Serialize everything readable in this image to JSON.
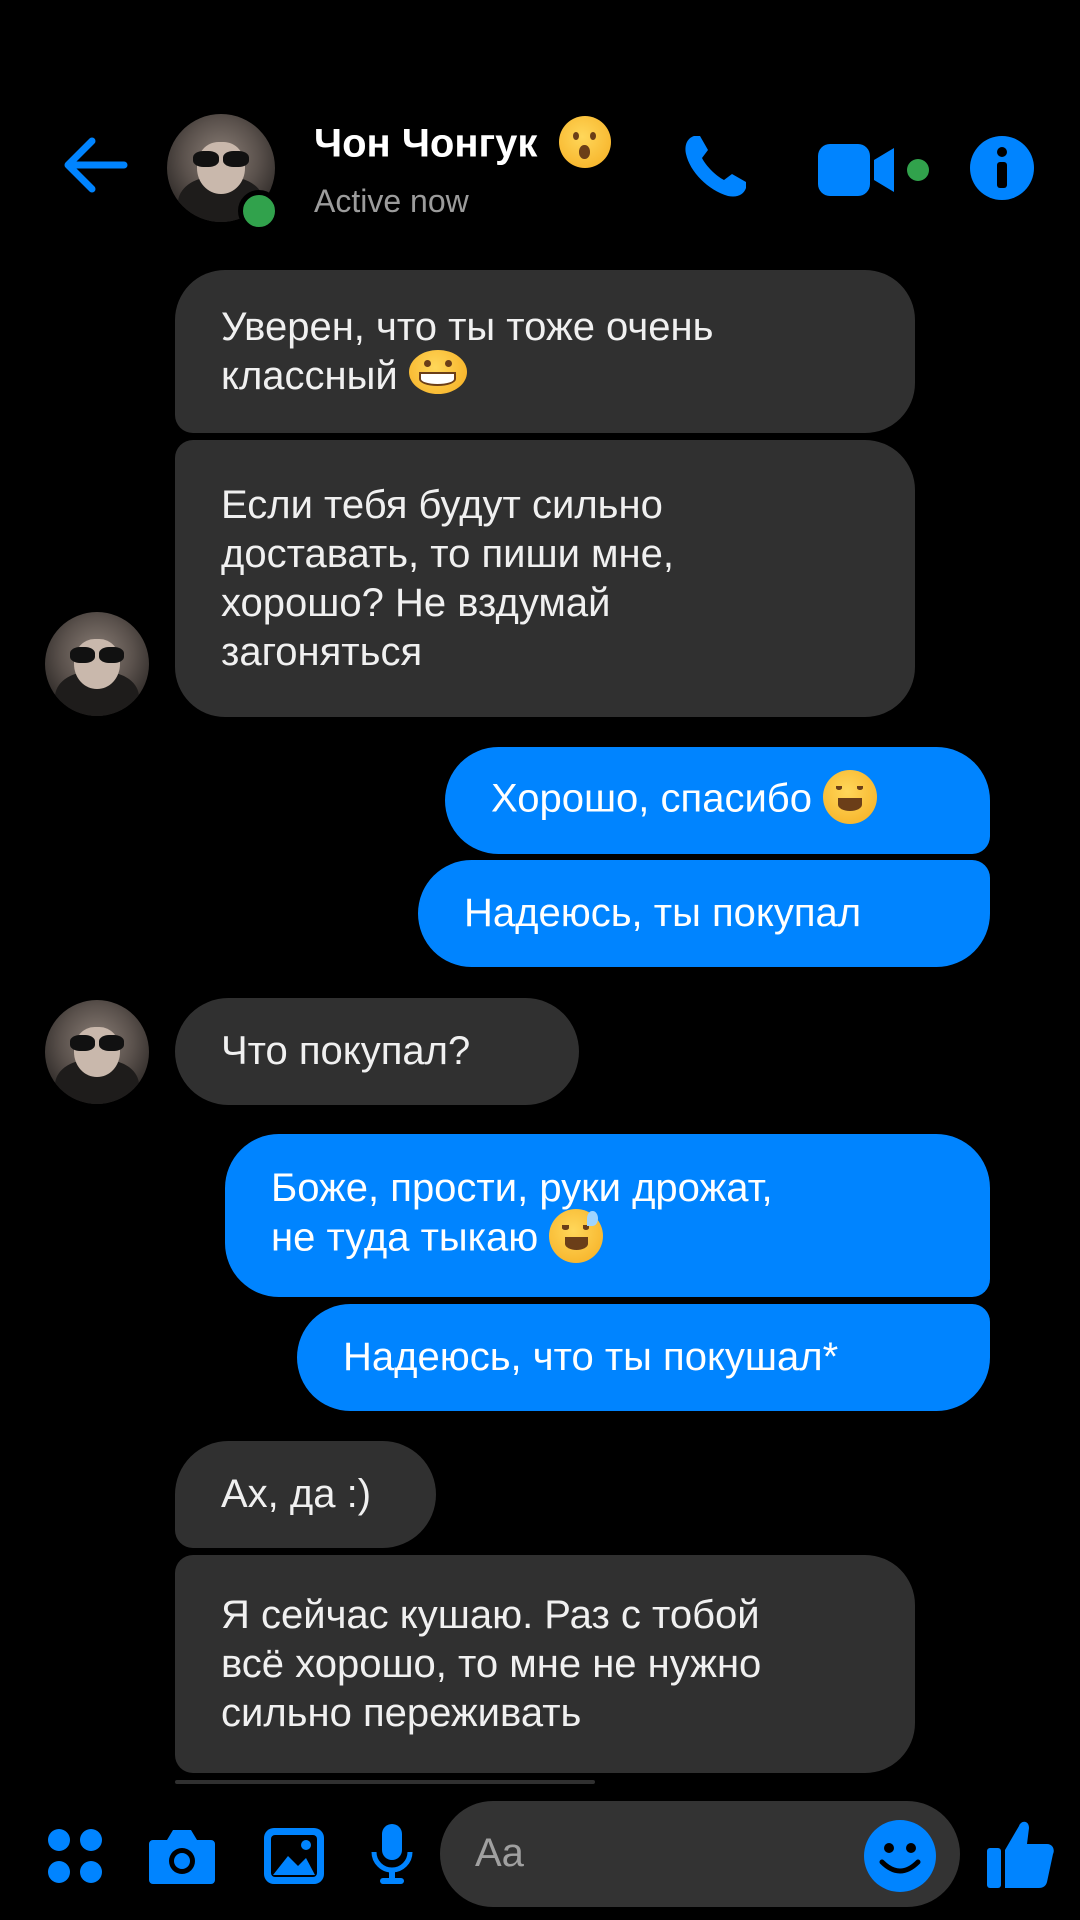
{
  "header": {
    "contact_name": "Чон Чонгук",
    "status": "Active now",
    "name_emoji": "surprised-face-emoji"
  },
  "colors": {
    "accent": "#0084ff",
    "incoming_bubble": "#303030",
    "online": "#31a24c",
    "background": "#000000"
  },
  "messages": [
    {
      "direction": "in",
      "text": "Уверен, что ты тоже очень\nклассный",
      "emoji": "grinning-face-emoji"
    },
    {
      "direction": "in",
      "text": "Если тебя будут сильно\nдоставать, то пиши мне,\nхорошо? Не вздумай\nзагоняться"
    },
    {
      "direction": "out",
      "text": "Хорошо, спасибо",
      "emoji": "smiling-face-emoji"
    },
    {
      "direction": "out",
      "text": "Надеюсь, ты покупал"
    },
    {
      "direction": "in",
      "text": "Что покупал?"
    },
    {
      "direction": "out",
      "text": "Боже, прости, руки дрожат,\nне туда тыкаю",
      "emoji": "sweat-smile-emoji"
    },
    {
      "direction": "out",
      "text": "Надеюсь, что ты покушал*"
    },
    {
      "direction": "in",
      "text": "Ах, да :)"
    },
    {
      "direction": "in",
      "text": "Я сейчас кушаю. Раз с тобой\nвсё хорошо, то мне не нужно\nсильно переживать"
    }
  ],
  "composer": {
    "placeholder": "Aa"
  },
  "icons": {
    "back": "back-arrow-icon",
    "call": "phone-icon",
    "video": "video-camera-icon",
    "info": "info-icon",
    "menu": "apps-menu-icon",
    "camera": "camera-icon",
    "gallery": "image-icon",
    "mic": "microphone-icon",
    "emoji": "emoji-icon",
    "like": "thumbs-up-icon"
  }
}
